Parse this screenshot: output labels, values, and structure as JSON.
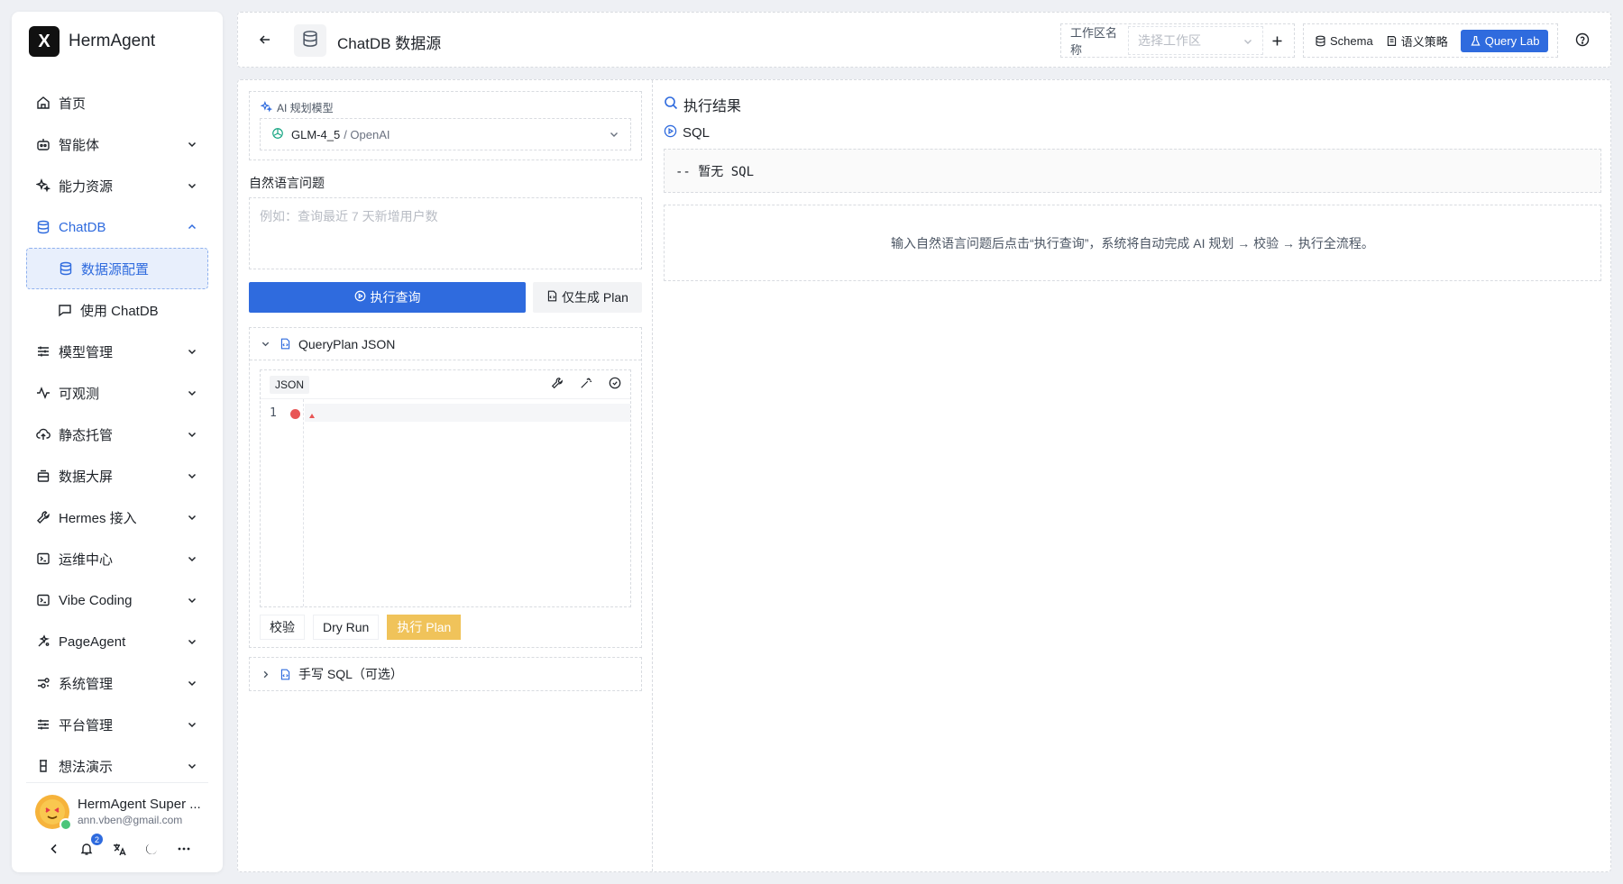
{
  "app": {
    "name": "HermAgent",
    "logo_letter": "X"
  },
  "sidebar": {
    "items": [
      {
        "label": "首页",
        "icon": "home-icon",
        "expandable": false
      },
      {
        "label": "智能体",
        "icon": "robot-icon",
        "expandable": true
      },
      {
        "label": "能力资源",
        "icon": "sparkles-icon",
        "expandable": true
      },
      {
        "label": "ChatDB",
        "icon": "database-icon",
        "expandable": true,
        "open": true
      },
      {
        "label": "数据源配置",
        "icon": "database-icon",
        "sub": true,
        "active": true
      },
      {
        "label": "使用 ChatDB",
        "icon": "chat-icon",
        "sub": true
      },
      {
        "label": "模型管理",
        "icon": "sliders-icon",
        "expandable": true
      },
      {
        "label": "可观测",
        "icon": "pulse-icon",
        "expandable": true
      },
      {
        "label": "静态托管",
        "icon": "cloud-upload-icon",
        "expandable": true
      },
      {
        "label": "数据大屏",
        "icon": "monitor-icon",
        "expandable": true
      },
      {
        "label": "Hermes 接入",
        "icon": "wrench-icon",
        "expandable": true
      },
      {
        "label": "运维中心",
        "icon": "terminal-icon",
        "expandable": true
      },
      {
        "label": "Vibe Coding",
        "icon": "code-icon",
        "expandable": true
      },
      {
        "label": "PageAgent",
        "icon": "agent-icon",
        "expandable": true
      },
      {
        "label": "系统管理",
        "icon": "settings-icon",
        "expandable": true
      },
      {
        "label": "平台管理",
        "icon": "sliders-icon",
        "expandable": true
      },
      {
        "label": "想法演示",
        "icon": "flask-icon",
        "expandable": true
      }
    ],
    "user": {
      "name": "HermAgent Super ...",
      "email": "ann.vben@gmail.com"
    },
    "notifications": "2"
  },
  "header": {
    "title": "ChatDB 数据源",
    "workspace_label": "工作区名称",
    "workspace_placeholder": "选择工作区",
    "tabs": [
      {
        "label": "Schema",
        "icon": "database-icon",
        "active": false
      },
      {
        "label": "语义策略",
        "icon": "book-icon",
        "active": false
      },
      {
        "label": "Query Lab",
        "icon": "flask-icon",
        "active": true
      }
    ]
  },
  "left": {
    "model_label": "AI 规划模型",
    "model_name": "GLM-4_5",
    "model_provider": "/ OpenAI",
    "question_label": "自然语言问题",
    "question_placeholder": "例如：查询最近 7 天新增用户数",
    "exec_button": "执行查询",
    "plan_button": "仅生成 Plan",
    "queryplan_title": "QueryPlan JSON",
    "editor_lang": "JSON",
    "line_number": "1",
    "validate_button": "校验",
    "dryrun_button": "Dry Run",
    "execplan_button": "执行 Plan",
    "sql_section": "手写 SQL（可选）"
  },
  "right": {
    "result_title": "执行结果",
    "sql_title": "SQL",
    "sql_empty": "-- 暂无 SQL",
    "hint": "输入自然语言问题后点击“执行查询”，系统将自动完成 AI 规划 → 校验 → 执行全流程。"
  },
  "colors": {
    "primary": "#2f6bde",
    "warning": "#f0c35a",
    "error": "#e85555"
  }
}
